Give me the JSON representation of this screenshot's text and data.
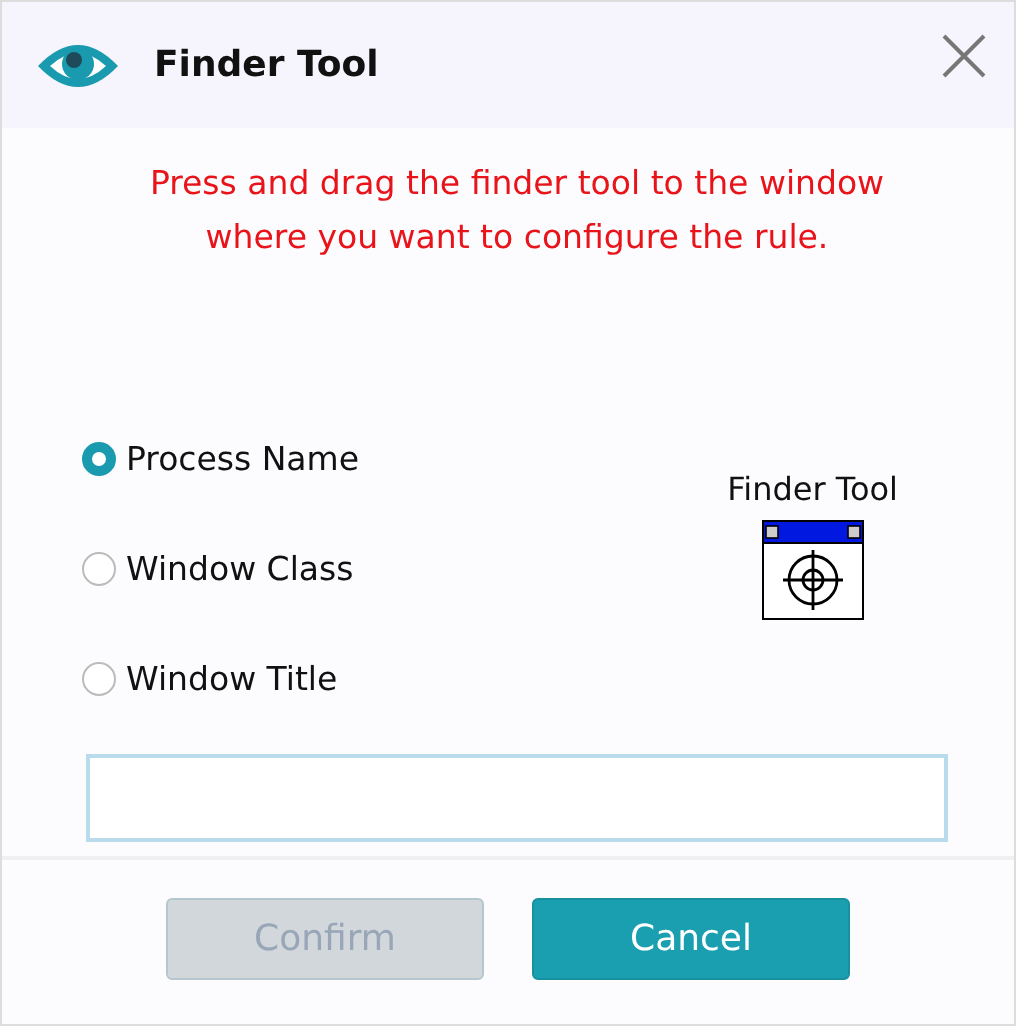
{
  "window": {
    "title": "Finder Tool"
  },
  "message": "Press and drag the finder tool to the window where you want to configure the rule.",
  "options": [
    {
      "label": "Process Name",
      "selected": true
    },
    {
      "label": "Window Class",
      "selected": false
    },
    {
      "label": "Window Title",
      "selected": false
    }
  ],
  "finder": {
    "label": "Finder Tool"
  },
  "buttons": [
    {
      "label": "Confirm",
      "kind": "secondary",
      "disabled": true
    },
    {
      "label": "Cancel",
      "kind": "primary",
      "disabled": false
    }
  ]
}
